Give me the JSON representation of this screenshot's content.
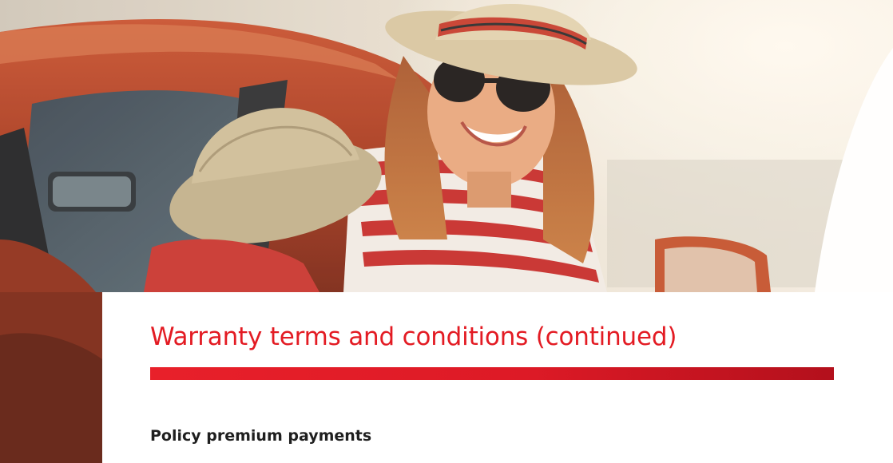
{
  "hero": {
    "image": "photo of a smiling woman in a straw sun hat, sunglasses and red-and-white striped top leaning out of a red car, with a child wearing a sun hat in the foreground"
  },
  "document": {
    "title": "Warranty terms and conditions (continued)",
    "section_heading": "Policy premium payments"
  },
  "colors": {
    "accent": "#e31b23",
    "accent_dark": "#b3101c",
    "heading_text": "#1f1f1f",
    "background": "#ffffff"
  }
}
